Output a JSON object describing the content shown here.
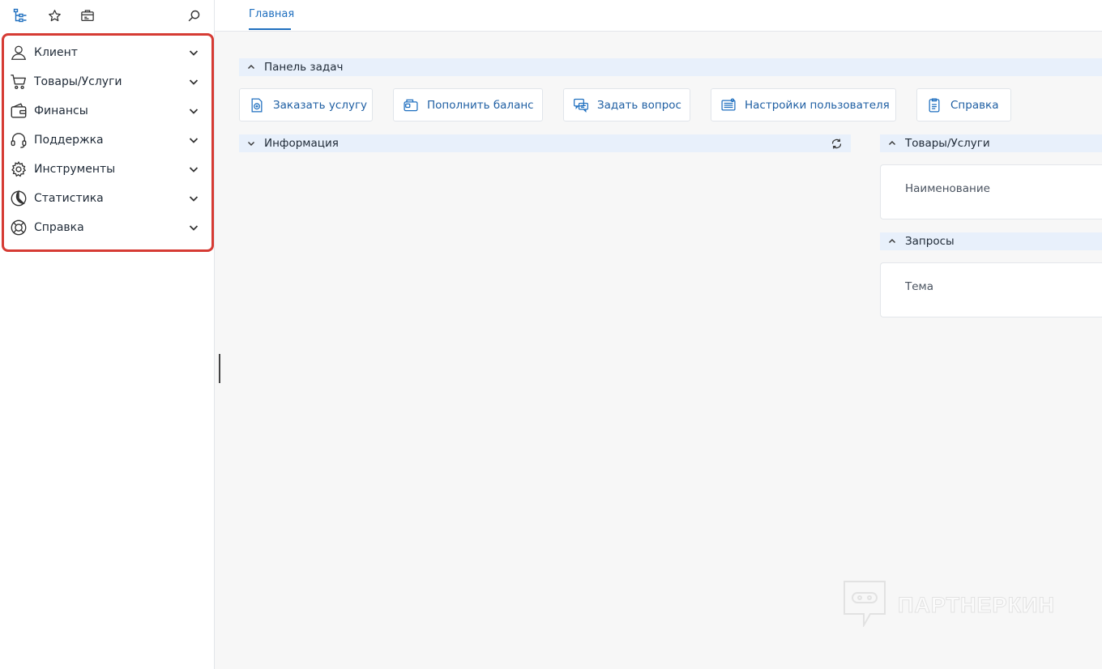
{
  "tabs": {
    "active": "Главная"
  },
  "menu": [
    {
      "label": "Клиент",
      "icon": "user-icon"
    },
    {
      "label": "Товары/Услуги",
      "icon": "cart-icon"
    },
    {
      "label": "Финансы",
      "icon": "wallet-icon"
    },
    {
      "label": "Поддержка",
      "icon": "headset-icon"
    },
    {
      "label": "Инструменты",
      "icon": "gear-icon"
    },
    {
      "label": "Статистика",
      "icon": "pie-chart-icon"
    },
    {
      "label": "Справка",
      "icon": "lifebuoy-icon"
    }
  ],
  "taskpanel": {
    "title": "Панель задач",
    "buttons": [
      {
        "label": "Заказать услугу",
        "icon": "order-service-icon"
      },
      {
        "label": "Пополнить баланс",
        "icon": "wallet-plus-icon"
      },
      {
        "label": "Задать вопрос",
        "icon": "chat-question-icon"
      },
      {
        "label": "Настройки пользователя",
        "icon": "user-settings-icon"
      },
      {
        "label": "Справка",
        "icon": "help-document-icon"
      }
    ]
  },
  "info": {
    "title": "Информация"
  },
  "products": {
    "title": "Товары/Услуги",
    "column": "Наименование"
  },
  "requests": {
    "title": "Запросы",
    "column": "Тема"
  },
  "watermark": {
    "text": "ПАРТНЕРКИН"
  },
  "colors": {
    "accent": "#1f6fbf",
    "highlight_border": "#d63b34",
    "section_bg": "#e8f0fb"
  }
}
